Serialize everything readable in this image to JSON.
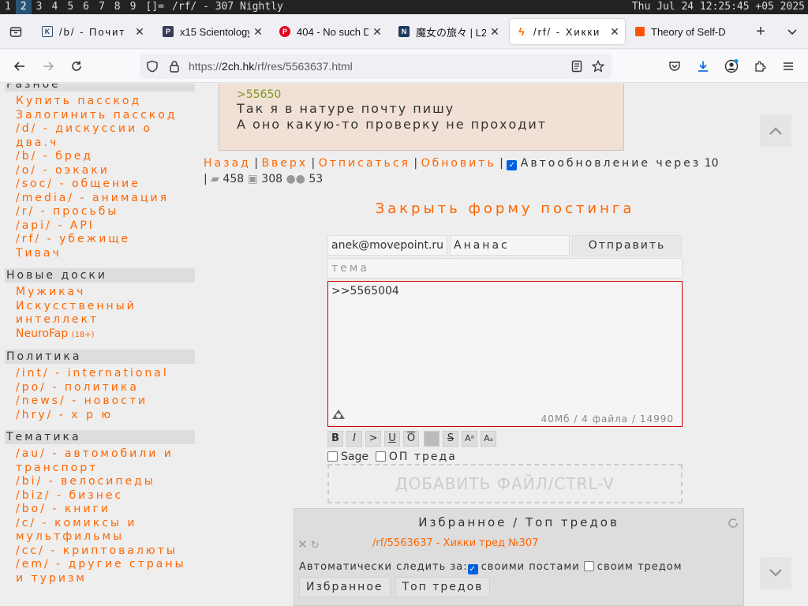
{
  "wm": {
    "workspaces": [
      "1",
      "2",
      "3",
      "4",
      "5",
      "6",
      "7",
      "8",
      "9"
    ],
    "layout": "[]=",
    "title": "/rf/ -    307  Nightly",
    "clock": "Thu Jul 24 12:25:45 +05 2025"
  },
  "tabs": [
    {
      "label": "/b/ - Почит",
      "favicon": "2ch",
      "color": "#2b4a70"
    },
    {
      "label": "x15 Scientology",
      "favicon": "P",
      "color": "#3a3a5a"
    },
    {
      "label": "404 - No such D",
      "favicon": "P",
      "color": "#e60023"
    },
    {
      "label": "魔女の旅々 | L2",
      "favicon": "N",
      "color": "#1f3a5f"
    },
    {
      "label": "/rf/ - Хикки",
      "favicon": "bolt",
      "color": "#ff6600"
    },
    {
      "label": "Theory of Self-D",
      "favicon": "sq",
      "color": "#ff5500"
    }
  ],
  "nav": {
    "url_prefix": "https://",
    "url_host": "2ch.hk",
    "url_path": "/rf/res/5563637.html"
  },
  "sidebar": {
    "sections": [
      {
        "title": "Разное",
        "links": [
          "Купить пасскод",
          "Залогинить пасскод",
          "/d/ - дискуссии о два.ч",
          "/b/ - бред",
          "/o/ - оэкаки",
          "/soc/ - общение",
          "/media/ - анимация",
          "/r/ - просьбы",
          "/api/ - API",
          "/rf/ - убежище",
          "Тивач"
        ]
      },
      {
        "title": "Новые доски",
        "links": [
          "Мужикач",
          "Искусственный интеллект",
          "NeuroFap"
        ],
        "tag": "(18+)"
      },
      {
        "title": "Политика",
        "links": [
          "/int/ - international",
          "/po/ - политика",
          "/news/ - новости",
          "/hry/ - х р ю"
        ]
      },
      {
        "title": "Тематика",
        "links": [
          "/au/ - автомобили и транспорт",
          "/bi/ - велосипеды",
          "/biz/ - бизнес",
          "/bo/ - книги",
          "/c/ - комиксы и мультфильмы",
          "/cc/ - криптовалюты",
          "/em/ - другие страны и туризм"
        ]
      }
    ]
  },
  "post": {
    "reply_ref": ">55650",
    "line1": "Так я в натуре почту пишу",
    "line2": "А оно какую-то проверку не проходит"
  },
  "threadnav": {
    "back": "Назад",
    "up": "Вверх",
    "unsubscribe": "Отписаться",
    "refresh": "Обновить",
    "auto_label": "Автообновление через",
    "auto_seconds": "10",
    "posts": "458",
    "images": "308",
    "users": "53"
  },
  "form": {
    "close_label": "Закрыть форму постинга",
    "email": "anek@movepoint.ru",
    "name": "Ананас",
    "send": "Отправить",
    "subject_placeholder": "тема",
    "comment": ">>5565004",
    "counter": "40Мб / 4 файла / 14990",
    "markup": [
      "B",
      "I",
      ">",
      "U",
      "O",
      "",
      "S",
      "Aᵃ",
      "Aₐ"
    ],
    "sage": "Sage",
    "op": "ОП треда",
    "add_file": "ДОБАВИТЬ ФАЙЛ/CTRL-V"
  },
  "favorites": {
    "title": "Избранное / Топ тредов",
    "thread": "/rf/5563637 - Хикки тред №307",
    "auto_label": "Автоматически следить за:",
    "own_posts": "своими постами",
    "own_thread": "своим тредом",
    "tab_fav": "Избранное",
    "tab_top": "Топ тредов"
  }
}
